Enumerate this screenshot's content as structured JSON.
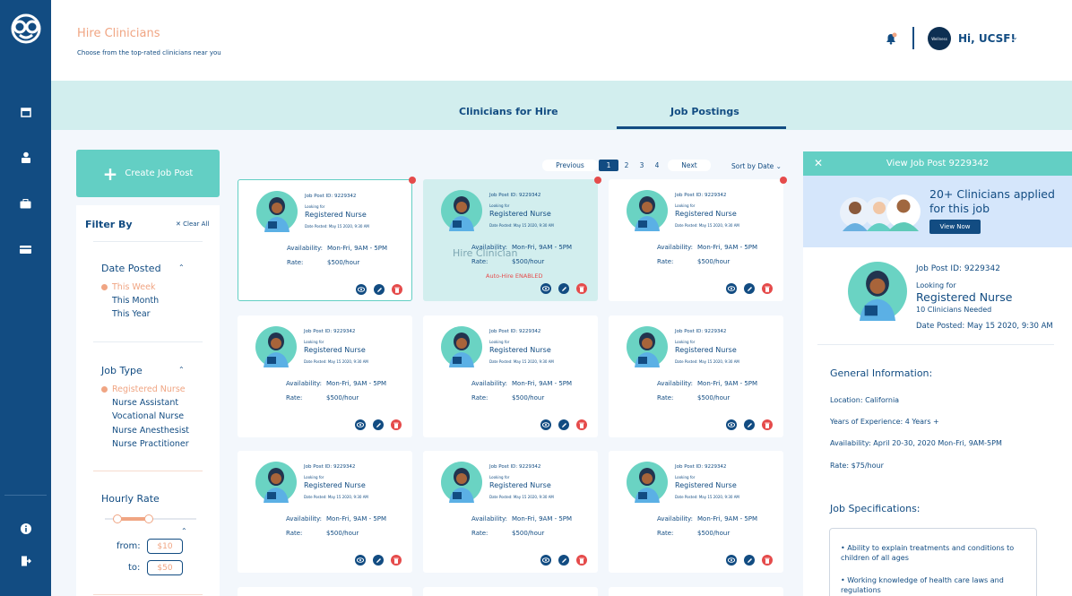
{
  "header": {
    "title": "Hire Clinicians",
    "subtitle": "Choose from the top-rated clinicians near you",
    "avatar_text": "Wellness",
    "greeting": "Hi, UCSF!"
  },
  "sidebar": {
    "icons": [
      "logo-icon",
      "calendar-icon",
      "clinician-icon",
      "briefcase-icon",
      "card-icon",
      "info-icon",
      "logout-icon"
    ]
  },
  "tabs": [
    {
      "label": "Clinicians for Hire",
      "active": false
    },
    {
      "label": "Job Postings",
      "active": true
    }
  ],
  "create_button": "Create Job Post",
  "filter": {
    "title": "Filter By",
    "clear": "Clear All",
    "date_posted": {
      "label": "Date Posted",
      "options": [
        "This Week",
        "This Month",
        "This Year"
      ],
      "selected": "This Week"
    },
    "job_type": {
      "label": "Job Type",
      "options": [
        "Registered Nurse",
        "Nurse Assistant",
        "Vocational Nurse",
        "Nurse Anesthesist",
        "Nurse Practitioner"
      ],
      "selected": "Registered Nurse"
    },
    "hourly_rate": {
      "label": "Hourly Rate",
      "from_label": "from:",
      "to_label": "to:",
      "from": "$10",
      "to": "$50"
    }
  },
  "pagination": {
    "previous": "Previous",
    "pages": [
      "1",
      "2",
      "3",
      "4"
    ],
    "active_page": "1",
    "next": "Next"
  },
  "sort": "Sort by Date",
  "card": {
    "id": "Job Post ID: 9229342",
    "looking": "Looking for",
    "role": "Registered Nurse",
    "date": "Date Posted: May 15 2020, 9:30 AM",
    "availability_label": "Availability:",
    "availability": "Mon-Fri, 9AM - 5PM",
    "rate_label": "Rate:",
    "rate": "$500/hour",
    "hover_text": "Hire Clinician",
    "auto_hire": "Auto-Hire ENABLED"
  },
  "detail_panel": {
    "header": "View Job Post 9229342",
    "banner_text": "20+ Clinicians applied for this job",
    "banner_button": "View Now",
    "id": "Job Post ID: 9229342",
    "looking": "Looking for",
    "role": "Registered Nurse",
    "needed": "10 Clinicians Needed",
    "posted": "Date Posted: May 15 2020, 9:30 AM",
    "general_title": "General Information:",
    "location": "Location: California",
    "experience": "Years of Experience: 4 Years +",
    "availability": "Availability: April 20-30, 2020 Mon-Fri, 9AM-5PM",
    "rate": "Rate: $75/hour",
    "specs_title": "Job Specifications:",
    "specs": [
      "• Ability to explain treatments and conditions to children of all ages",
      "• Working knowledge of health care laws and regulations"
    ]
  },
  "colors": {
    "navy": "#124c82",
    "teal": "#63cfc4",
    "peach": "#f0a583",
    "red": "#e54b4b"
  }
}
